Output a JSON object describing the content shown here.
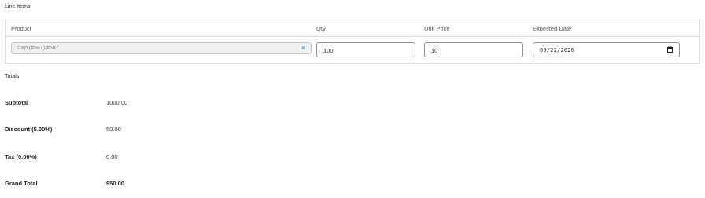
{
  "line_items": {
    "title": "Line Items",
    "headers": {
      "product": "Product",
      "qty": "Qty",
      "unit_price": "Unit Price",
      "expected_date": "Expected Date"
    },
    "row": {
      "product": "Cap (#587) #587",
      "clear_glyph": "×",
      "qty": "100",
      "unit_price": "10",
      "expected_date": "09/22/2026"
    }
  },
  "totals": {
    "title": "Totals",
    "subtotal_label": "Subtotal",
    "subtotal_value": "1000.00",
    "discount_label": "Discount (5.00%)",
    "discount_value": "50.00",
    "tax_label": "Tax (0.00%)",
    "tax_value": "0.00",
    "grand_total_label": "Grand Total",
    "grand_total_value": "950.00"
  },
  "icons": {
    "clear": "close-icon",
    "date": "calendar-icon"
  },
  "colors": {
    "accent": "#2271b1",
    "border": "#dcdcde",
    "select_bg": "#f0f0f1"
  }
}
